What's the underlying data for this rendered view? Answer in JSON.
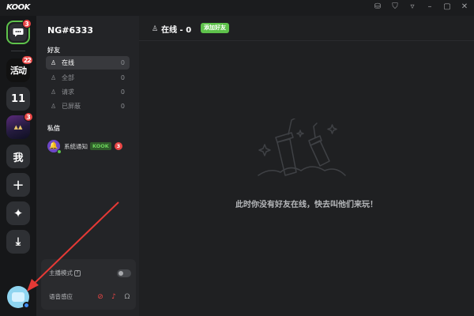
{
  "app": {
    "logo_text": "KOOK"
  },
  "titlebar": {
    "icons": [
      "database-icon",
      "shirt-icon",
      "filter-icon",
      "minimize-icon",
      "maximize-icon",
      "close-icon"
    ]
  },
  "rail": {
    "dm_badge": "3",
    "servers": [
      {
        "label": "活动",
        "badge": "22"
      },
      {
        "label": "11",
        "badge": ""
      },
      {
        "label": "",
        "badge": "3"
      },
      {
        "label": "我",
        "badge": ""
      }
    ],
    "add_symbol": "+",
    "explore_symbol": "✦",
    "download_symbol": "⤓"
  },
  "panel": {
    "username": "NG#6333",
    "friends_section": "好友",
    "nav": [
      {
        "label": "在线",
        "count": "0"
      },
      {
        "label": "全部",
        "count": "0"
      },
      {
        "label": "请求",
        "count": "0"
      },
      {
        "label": "已屏蔽",
        "count": "0"
      }
    ],
    "dm_section": "私信",
    "dm": {
      "name": "系统通知",
      "tag": "KOOK",
      "badge": "3"
    },
    "streamer_mode": "主播模式",
    "voice_detect": "语音感应"
  },
  "main": {
    "online_title": "在线 - 0",
    "add_friend": "添加好友",
    "empty_message": "此时你没有好友在线，快去叫他们来玩！"
  },
  "colors": {
    "accent": "#5ec24b",
    "badge": "#ea4645",
    "annotation": "#e53935"
  }
}
